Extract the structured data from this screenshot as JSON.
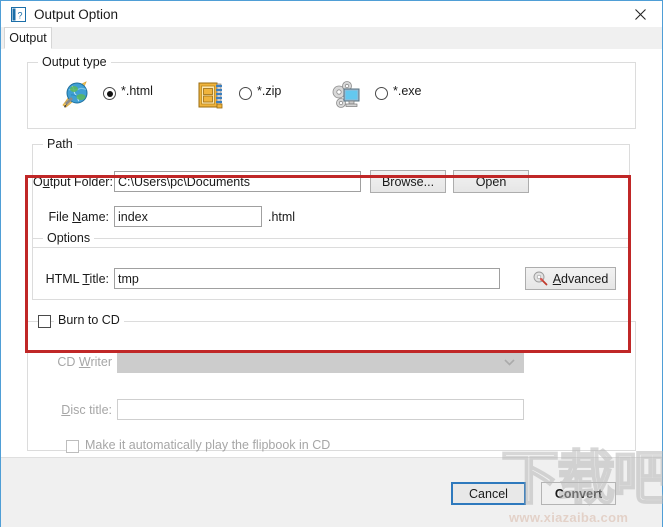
{
  "window": {
    "title": "Output Option",
    "app_icon": "help-document-icon",
    "close_icon": "close-icon"
  },
  "tabs": [
    {
      "label": "Output",
      "selected": true
    }
  ],
  "output_type": {
    "group_title": "Output type",
    "options": [
      {
        "label": "*.html",
        "icon": "globe-pen-icon",
        "checked": true
      },
      {
        "label": "*.zip",
        "icon": "zip-archive-icon",
        "checked": false
      },
      {
        "label": "*.exe",
        "icon": "gears-monitor-icon",
        "checked": false
      }
    ]
  },
  "path": {
    "group_title": "Path",
    "output_folder": {
      "label_pre": "O",
      "label_mn": "u",
      "label_post": "tput Folder:",
      "value": "C:\\Users\\pc\\Documents",
      "placeholder": ""
    },
    "browse_button": "Browse...",
    "open_button": "Open",
    "file_name": {
      "label_pre": "File ",
      "label_mn": "N",
      "label_post": "ame:",
      "value": "index",
      "placeholder": ""
    },
    "extension_suffix": ".html"
  },
  "options": {
    "group_title": "Options",
    "html_title": {
      "label_pre": "HTML ",
      "label_mn": "T",
      "label_post": "itle:",
      "value": "tmp",
      "placeholder": ""
    },
    "advanced_button": {
      "label_pre": "",
      "label_mn": "A",
      "label_post": "dvanced",
      "icon": "gear-wrench-icon"
    }
  },
  "burn_to_cd": {
    "checkbox_label": "Burn to CD",
    "checked": false,
    "cd_writer": {
      "label_pre": "CD ",
      "label_mn": "W",
      "label_post": "riter",
      "value": "",
      "disabled": true,
      "arrow_icon": "chevron-down-icon"
    },
    "disc_title": {
      "label_pre": "",
      "label_mn": "D",
      "label_post": "isc title:",
      "value": "",
      "placeholder": "",
      "disabled": true
    },
    "autoplay": {
      "label": "Make it automatically play the flipbook in CD",
      "checked": false,
      "disabled": true
    }
  },
  "footer": {
    "cancel_button": "Cancel",
    "convert_button": "Convert"
  },
  "watermark": {
    "glyphs": "下载吧",
    "url": "www.xiazaiba.com"
  },
  "colors": {
    "highlight_red": "#c02727",
    "accent_blue": "#2e79bd",
    "window_border": "#4f9ed6",
    "disabled_grey": "#a6a6a6"
  }
}
